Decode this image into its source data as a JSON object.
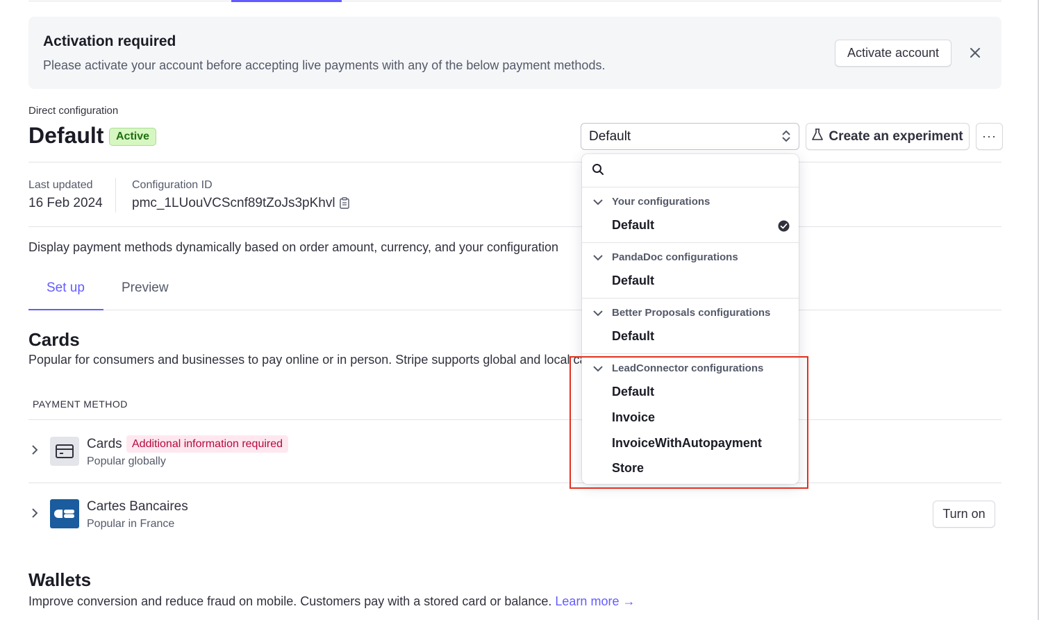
{
  "banner": {
    "title": "Activation required",
    "text": "Please activate your account before accepting live payments with any of the below payment methods.",
    "activate_label": "Activate account",
    "close_icon": "close-icon"
  },
  "header": {
    "section_label": "Direct configuration",
    "title": "Default",
    "status_badge": "Active",
    "select_value": "Default",
    "experiment_label": "Create an experiment",
    "more_label": "···"
  },
  "meta": {
    "last_updated_label": "Last updated",
    "last_updated_value": "16 Feb 2024",
    "config_id_label": "Configuration ID",
    "config_id_value": "pmc_1LUouVCScnf89tZoJs3pKhvl"
  },
  "description": "Display payment methods dynamically based on order amount, currency, and your configuration",
  "tabs": [
    {
      "label": "Set up",
      "active": true
    },
    {
      "label": "Preview",
      "active": false
    }
  ],
  "cards_section": {
    "heading": "Cards",
    "description": "Popular for consumers and businesses to pay online or in person. Stripe supports global and local card networks.",
    "column_header": "PAYMENT METHOD",
    "methods": [
      {
        "name": "Cards",
        "badge": "Additional information required",
        "subtitle": "Popular globally"
      },
      {
        "name": "Cartes Bancaires",
        "subtitle": "Popular in France",
        "action": "Turn on"
      }
    ]
  },
  "wallets_section": {
    "heading": "Wallets",
    "description": "Improve conversion and reduce fraud on mobile. Customers pay with a stored card or balance.",
    "learn_more": "Learn more →"
  },
  "dropdown": {
    "search_placeholder": "",
    "groups": [
      {
        "label": "Your configurations",
        "items": [
          "Default"
        ],
        "selected": "Default"
      },
      {
        "label": "PandaDoc configurations",
        "items": [
          "Default"
        ]
      },
      {
        "label": "Better Proposals configurations",
        "items": [
          "Default"
        ]
      },
      {
        "label": "LeadConnector configurations",
        "items": [
          "Default",
          "Invoice",
          "InvoiceWithAutopayment",
          "Store"
        ]
      }
    ]
  },
  "colors": {
    "accent": "#635bff",
    "highlight": "#e0301e",
    "active_badge_bg": "#d7f7c2",
    "warning_badge_bg": "#ffe7f0"
  }
}
